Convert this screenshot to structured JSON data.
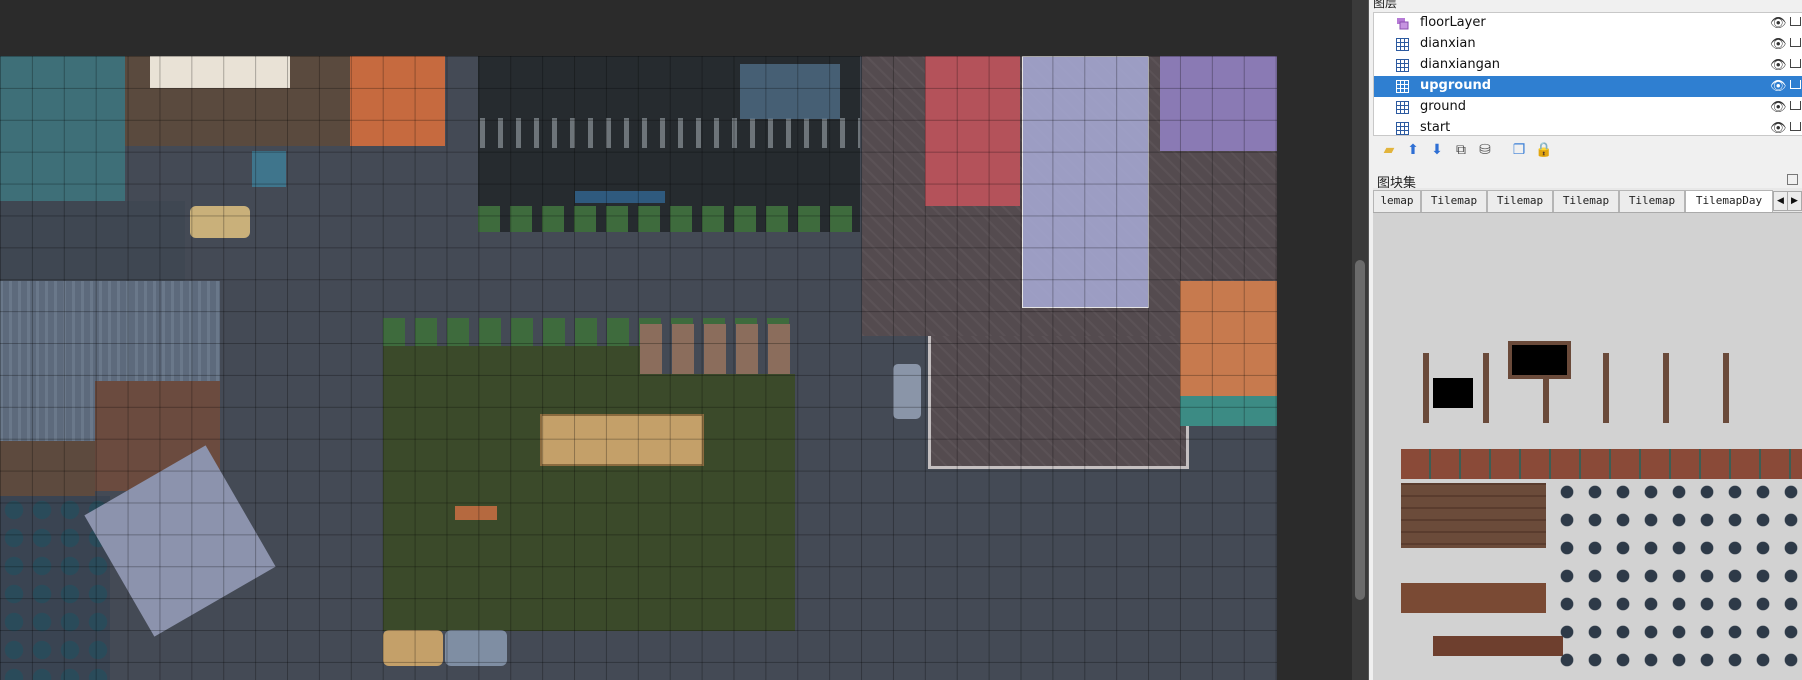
{
  "layers_panel": {
    "title": "图层",
    "layers": [
      {
        "name": "floorLayer",
        "icon": "object-layer-icon",
        "selected": false
      },
      {
        "name": "dianxian",
        "icon": "tile-layer-icon",
        "selected": false
      },
      {
        "name": "dianxiangan",
        "icon": "tile-layer-icon",
        "selected": false
      },
      {
        "name": "upground",
        "icon": "tile-layer-icon",
        "selected": true
      },
      {
        "name": "ground",
        "icon": "tile-layer-icon",
        "selected": false
      },
      {
        "name": "start",
        "icon": "tile-layer-icon",
        "selected": false
      }
    ],
    "toolbar_icons": [
      "new-layer-icon",
      "raise-layer-icon",
      "lower-layer-icon",
      "duplicate-layer-icon",
      "delete-layer-icon",
      "show-hide-layers-icon",
      "lock-layer-icon"
    ]
  },
  "tileset_panel": {
    "title": "图块集",
    "tabs": [
      "lemap",
      "Tilemap",
      "Tilemap",
      "Tilemap",
      "Tilemap",
      "TilemapDay"
    ],
    "active_tab": "TilemapDay",
    "nav_prev": "◀",
    "nav_next": "▶"
  },
  "colors": {
    "selection": "#2f7fd1",
    "map_ground": "#444a55",
    "park_overlay": "#3b4a2a",
    "panel_bg": "#f0f0f0"
  }
}
